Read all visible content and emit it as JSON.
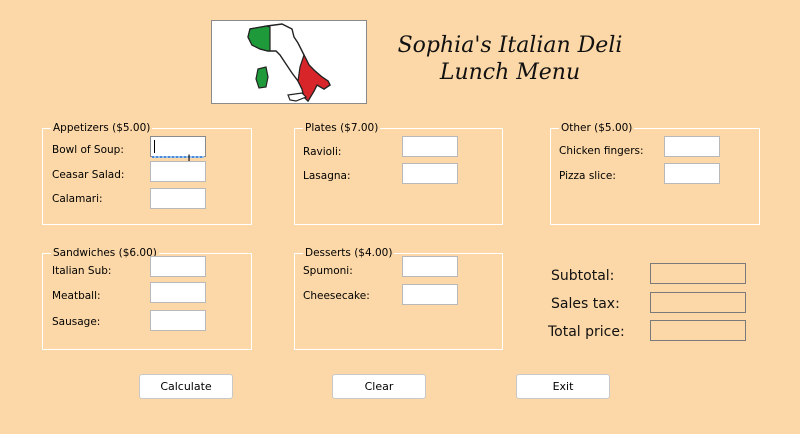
{
  "header": {
    "title_line1": "Sophia's Italian Deli",
    "title_line2": "Lunch Menu"
  },
  "logo": {
    "icon": "italy-flag-map-icon",
    "colors": {
      "green": "#1f9a3a",
      "white": "#ffffff",
      "red": "#d8252a"
    }
  },
  "appetizers": {
    "legend": "Appetizers ($5.00)",
    "items": [
      "Bowl of Soup:",
      "Ceasar Salad:",
      "Calamari:"
    ]
  },
  "plates": {
    "legend": "Plates ($7.00)",
    "items": [
      "Ravioli:",
      "Lasagna:"
    ]
  },
  "other": {
    "legend": "Other ($5.00)",
    "items": [
      "Chicken fingers:",
      "Pizza slice:"
    ]
  },
  "sandwiches": {
    "legend": "Sandwiches ($6.00)",
    "items": [
      "Italian Sub:",
      "Meatball:",
      "Sausage:"
    ]
  },
  "desserts": {
    "legend": "Desserts ($4.00)",
    "items": [
      "Spumoni:",
      "Cheesecake:"
    ]
  },
  "totals": {
    "subtotal_label": "Subtotal:",
    "sales_tax_label": "Sales tax:",
    "total_label": "Total price:"
  },
  "buttons": {
    "calculate": "Calculate",
    "clear": "Clear",
    "exit": "Exit"
  }
}
